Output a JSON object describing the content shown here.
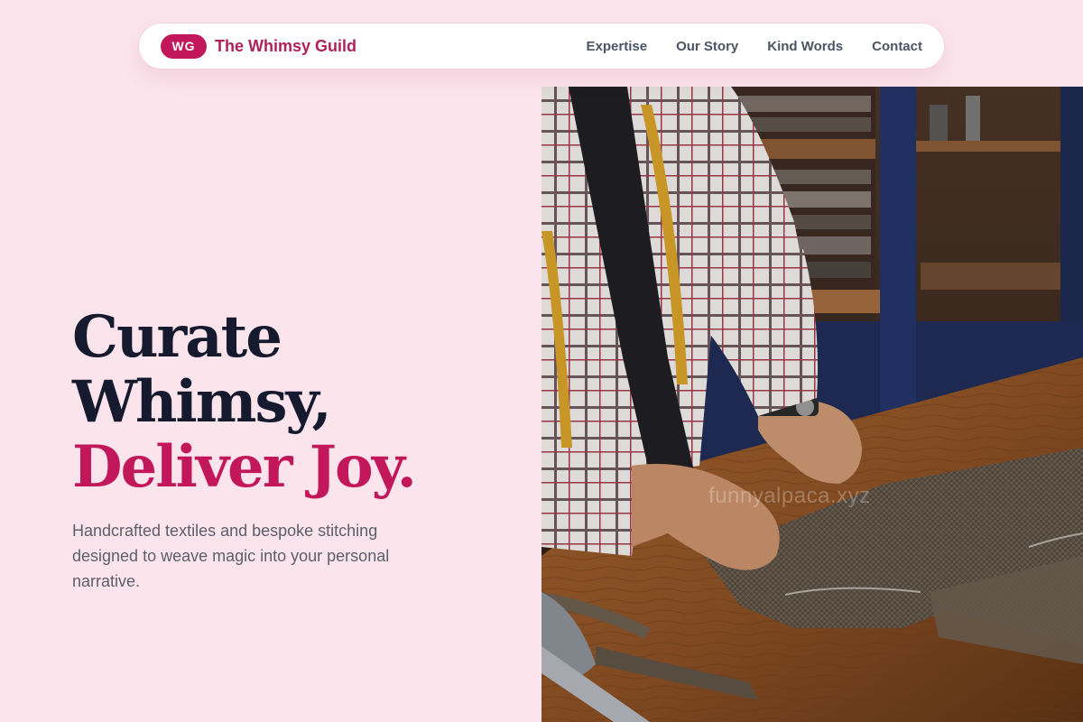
{
  "nav": {
    "badge": "WG",
    "brand_name": "The Whimsy Guild",
    "links": [
      "Expertise",
      "Our Story",
      "Kind Words",
      "Contact"
    ]
  },
  "hero": {
    "title_line1": "Curate",
    "title_line2": "Whimsy,",
    "title_line3": "Deliver Joy.",
    "subtitle": "Handcrafted textiles and bespoke stitching designed to weave magic into your personal narrative.",
    "image_watermark": "funnyalpaca.xyz"
  },
  "colors": {
    "background": "#fce4ec",
    "accent": "#c2185b",
    "heading": "#161a2e",
    "body_text": "#5b5f6b",
    "nav_text": "#4b5563"
  }
}
